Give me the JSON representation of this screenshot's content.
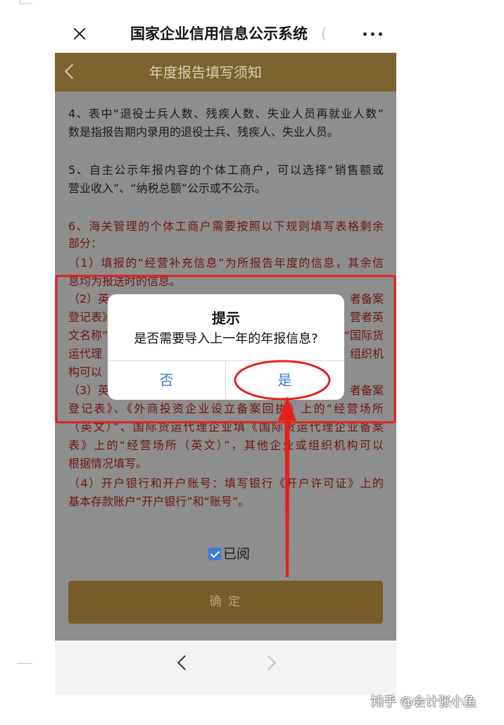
{
  "browser_bar": {
    "close_icon": "close-icon",
    "title": "国家企业信用信息公示系统",
    "title_overflow": "(",
    "more_icon": "more-dots-icon"
  },
  "header": {
    "back_icon": "chevron-left-icon",
    "title": "年度报告填写须知"
  },
  "notice": {
    "item4": [
      "4、表中“退役士兵人数、残疾人数、失业人员再就业人数”",
      "数是指报告期内录用的退役士兵、残疾人、失业人员。"
    ],
    "item5": [
      "5、自主公示年报内容的个体工商户，可以选择“销售额或",
      "营业收入”、“纳税总额”公示或不公示。"
    ],
    "item6": [
      "6、海关管理的个体工商户需要按照以下规则填写表格剩余",
      "部分：",
      "（1）填报的“经营补充信息”为所报告年度的信息，其余信",
      "息均为报送时的信息。"
    ],
    "item6_obscured_fragments": [
      {
        "left": "（2）英",
        "right": "者备案"
      },
      {
        "left": "登记表》、",
        "right": "营者英"
      },
      {
        "left": "文名称”",
        "right": "“国际货"
      },
      {
        "left": "运代理",
        "right": "组织机"
      },
      {
        "left": "构可以"
      },
      {
        "left": "（3）英",
        "right": "者备案"
      }
    ],
    "item6_continued": [
      "登记表》、《外商投资企业设立备案回执》上的“经营场所",
      "（英文）”、国际货运代理企业填《国际货运代理企业备案",
      "表》上的“经营场所（英文）”，其他企业或组织机构可以",
      "根据情况填写。",
      "（4）开户银行和开户账号：填写银行《开户许可证》上的",
      "基本存款账户“开户银行”和“账号”。"
    ]
  },
  "dialog": {
    "title": "提示",
    "message": "是否需要导入上一年的年报信息?",
    "cancel_label": "否",
    "confirm_label": "是"
  },
  "read_checkbox": {
    "checked": true,
    "label": "已阅"
  },
  "confirm_button": {
    "label": "确 定"
  },
  "bottom_nav": {
    "back_icon": "chevron-left-icon",
    "forward_icon": "chevron-right-icon",
    "forward_enabled": false
  },
  "watermark": {
    "text": "知乎 @会计张小鱼"
  },
  "colors": {
    "header_bg": "#7d632f",
    "header_text": "#d6cdb8",
    "content_bg": "#8e8e8e",
    "text": "#1b1b1b",
    "rule_text": "#6f1616",
    "dialog_button": "#3b7bd8",
    "checkbox": "#3b7bd8",
    "annotation": "#e3201c",
    "confirm_bg": "#775d29",
    "confirm_text": "#b8a680"
  }
}
